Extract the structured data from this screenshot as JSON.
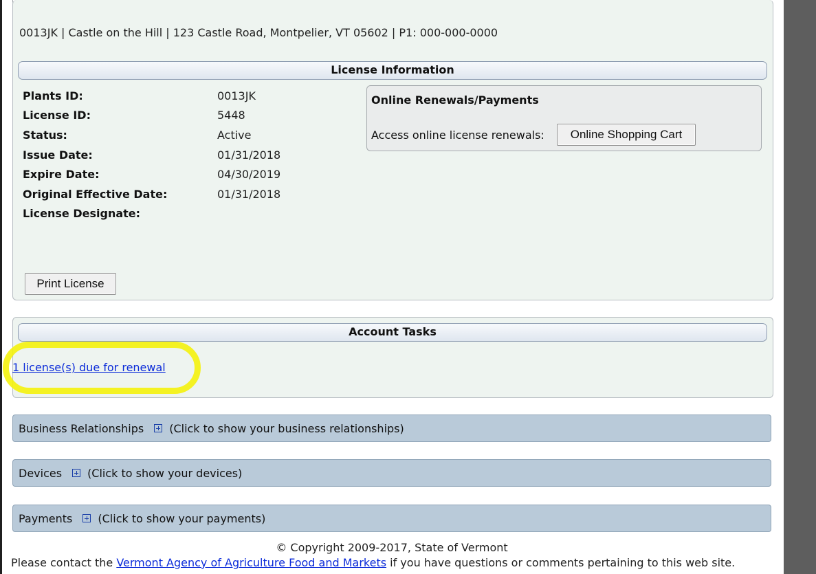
{
  "header": {
    "address_line": "0013JK | Castle on the Hill | 123 Castle Road, Montpelier, VT 05602 | P1: 000-000-0000"
  },
  "license_info": {
    "title": "License Information",
    "rows": [
      {
        "label": "Plants ID:",
        "value": "0013JK"
      },
      {
        "label": "License ID:",
        "value": "5448"
      },
      {
        "label": "Status:",
        "value": "Active"
      },
      {
        "label": "Issue Date:",
        "value": "01/31/2018"
      },
      {
        "label": "Expire Date:",
        "value": "04/30/2019"
      },
      {
        "label": "Original Effective Date:",
        "value": "01/31/2018"
      },
      {
        "label": "License Designate:",
        "value": ""
      }
    ],
    "print_button": "Print License",
    "online": {
      "title": "Online Renewals/Payments",
      "access_text": "Access online license renewals:",
      "cart_button": "Online Shopping Cart"
    }
  },
  "account_tasks": {
    "title": "Account Tasks",
    "renewal_link": "1 license(s) due for renewal"
  },
  "sections": [
    {
      "link": "Business Relationships",
      "hint": "(Click to show your business relationships)"
    },
    {
      "link": "Devices",
      "hint": "(Click to show your devices)"
    },
    {
      "link": "Payments",
      "hint": "(Click to show your payments)"
    }
  ],
  "footer": {
    "copyright": "© Copyright 2009-2017, State of Vermont",
    "contact_prefix": "Please contact the",
    "contact_link": "Vermont Agency of Agriculture Food and Markets",
    "contact_suffix": "if you have questions or comments pertaining to this web site."
  },
  "colors": {
    "panel_bg": "#eef4f0",
    "bar_bg": "#b9cad9",
    "link": "#0b2bd9",
    "highlight": "#f4f20c"
  }
}
